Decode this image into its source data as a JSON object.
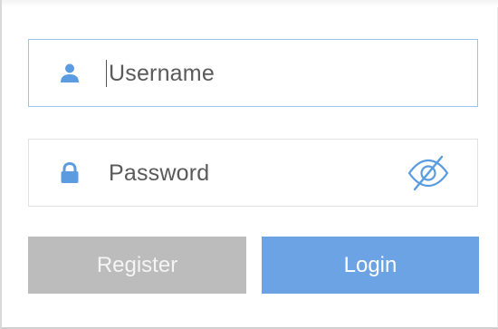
{
  "form": {
    "username": {
      "placeholder": "Username",
      "value": "",
      "icon": "user-icon"
    },
    "password": {
      "placeholder": "Password",
      "value": "",
      "icon": "lock-icon",
      "toggle_icon": "eye-slash-icon"
    },
    "register_label": "Register",
    "login_label": "Login"
  },
  "colors": {
    "accent": "#6ba3e4",
    "icon": "#5b9be0",
    "register_bg": "#bcbcbc",
    "focus_border": "#9ec2ee"
  }
}
